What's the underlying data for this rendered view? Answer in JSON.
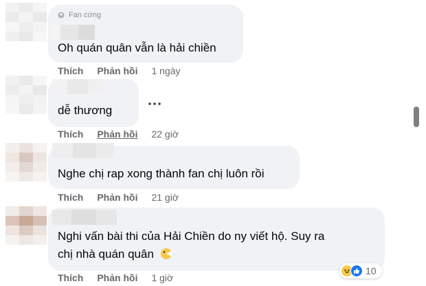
{
  "comments": [
    {
      "badge": "Fan cứng",
      "text": "Oh quán quân vẫn là hải chiền",
      "like": "Thích",
      "reply": "Phản hồi",
      "time": "1 ngày"
    },
    {
      "text": "dễ thương",
      "like": "Thích",
      "reply": "Phản hồi",
      "time": "22 giờ"
    },
    {
      "text": "Nghe chị rap xong thành fan chị luôn rồi",
      "like": "Thích",
      "reply": "Phản hồi",
      "time": "21 giờ"
    },
    {
      "text_line1": "Nghi vấn bài thi của Hải Chiền do ny viết hộ. Suy ra",
      "text_line2": "chị nhà quán quân",
      "like": "Thích",
      "reply": "Phản hồi",
      "time": "1 giờ",
      "reaction_count": "10",
      "reactions": [
        "haha-icon",
        "like-icon"
      ]
    }
  ],
  "colors": {
    "bubble": "#f0f2f5",
    "meta_text": "#65676b",
    "like_blue": "#1877f2",
    "haha_yellow": "#f7c948"
  }
}
